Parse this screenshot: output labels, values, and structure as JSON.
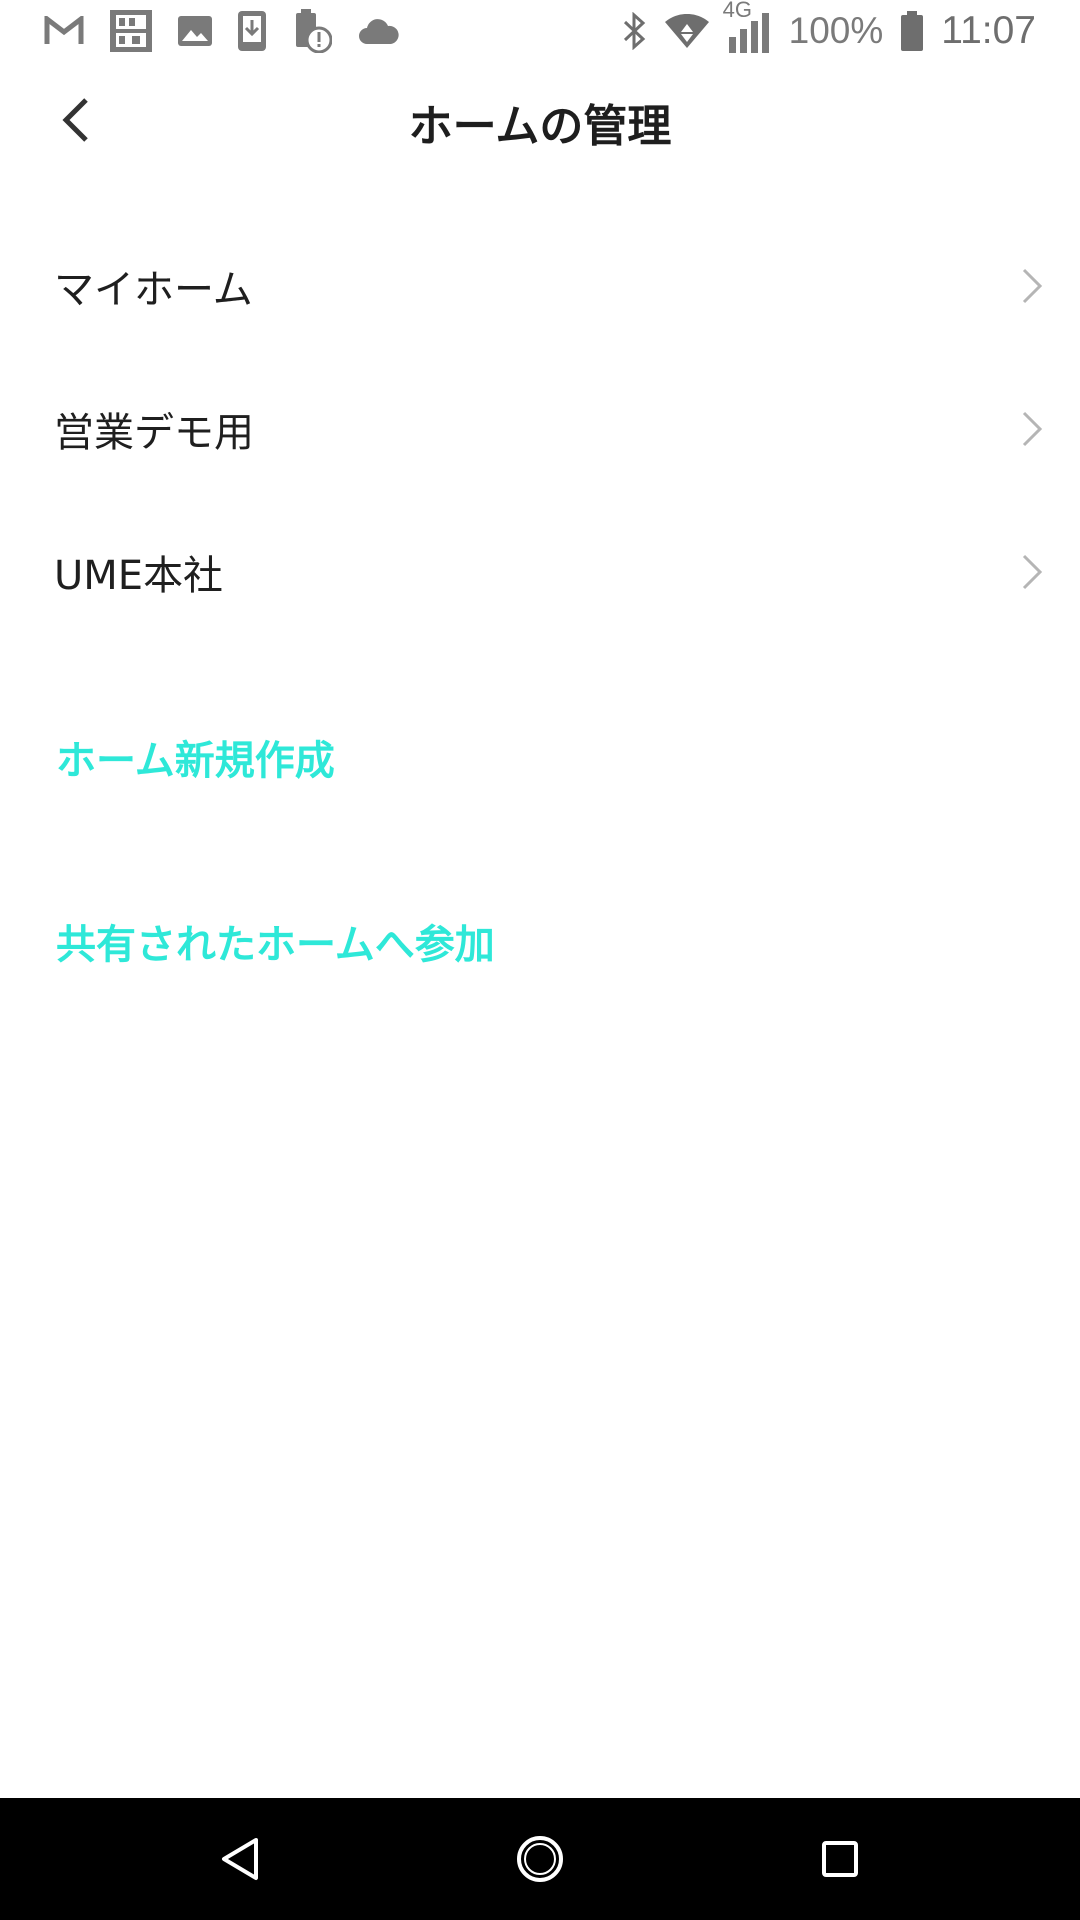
{
  "status_bar": {
    "battery_text": "100%",
    "network": "4G",
    "time": "11:07",
    "left_icons": [
      "gmail-icon",
      "iconit-icon",
      "image-icon",
      "download-icon",
      "battery-alert-icon",
      "cloud-icon"
    ],
    "right_icons": [
      "bluetooth-icon",
      "wifi-icon",
      "signal-icon",
      "battery-icon"
    ]
  },
  "header": {
    "title": "ホームの管理",
    "back_icon": "chevron-left-icon"
  },
  "homes": [
    {
      "label": "マイホーム"
    },
    {
      "label": "営業デモ用"
    },
    {
      "label": "UME本社"
    }
  ],
  "actions": {
    "create_home": "ホーム新規作成",
    "join_shared_home": "共有されたホームへ参加"
  },
  "colors": {
    "accent": "#2ee8d8",
    "text": "#1f1f1f",
    "chevron": "#b5b5b5",
    "nav_bar": "#000000"
  }
}
